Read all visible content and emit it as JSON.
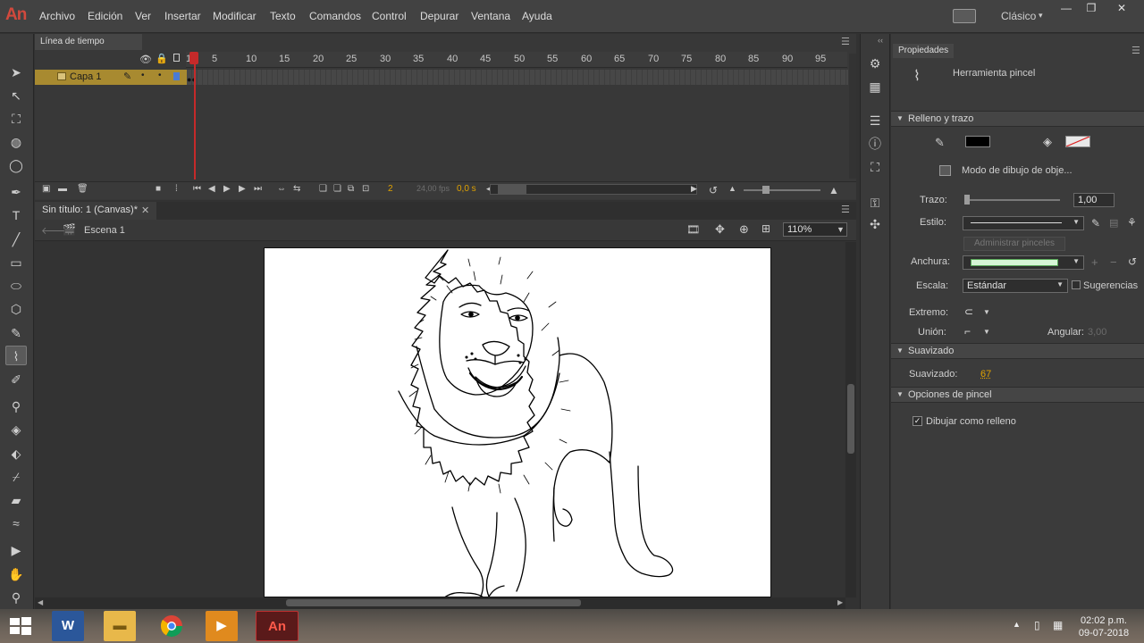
{
  "app": {
    "logo": "An"
  },
  "menu": [
    "Archivo",
    "Edición",
    "Ver",
    "Insertar",
    "Modificar",
    "Texto",
    "Comandos",
    "Control",
    "Depurar",
    "Ventana",
    "Ayuda"
  ],
  "workspace": {
    "label": "Clásico"
  },
  "timeline": {
    "tab": "Línea de tiempo",
    "frame_numbers": [
      "1",
      "5",
      "10",
      "15",
      "20",
      "25",
      "30",
      "35",
      "40",
      "45",
      "50",
      "55",
      "60",
      "65",
      "70",
      "75",
      "80",
      "85",
      "90",
      "95"
    ],
    "layer_name": "Capa 1",
    "current_frame": "2",
    "fps": "24,00 fps",
    "time": "0,0 s"
  },
  "document": {
    "tab_title": "Sin título: 1 (Canvas)*",
    "scene": "Escena 1",
    "zoom": "110%"
  },
  "properties": {
    "tab": "Propiedades",
    "tool_name": "Herramienta pincel",
    "section_fill_stroke": "Relleno y trazo",
    "object_drawing_mode": "Modo de dibujo de obje...",
    "stroke_label": "Trazo:",
    "stroke_value": "1,00",
    "style_label": "Estilo:",
    "manage_brushes": "Administrar pinceles",
    "width_label": "Anchura:",
    "scale_label": "Escala:",
    "scale_value": "Estándar",
    "hinting_label": "Sugerencias",
    "cap_label": "Extremo:",
    "join_label": "Unión:",
    "miter_label": "Angular:",
    "miter_value": "3,00",
    "section_smoothing": "Suavizado",
    "smoothing_label": "Suavizado:",
    "smoothing_value": "67",
    "section_brush_options": "Opciones de pincel",
    "draw_as_fill": "Dibujar como relleno",
    "fill_color": "#000000",
    "stroke_color": "#e8e8e8"
  },
  "taskbar": {
    "clock_time": "02:02 p.m.",
    "clock_date": "09-07-2018",
    "word_label": "W",
    "animate_label": "An"
  }
}
